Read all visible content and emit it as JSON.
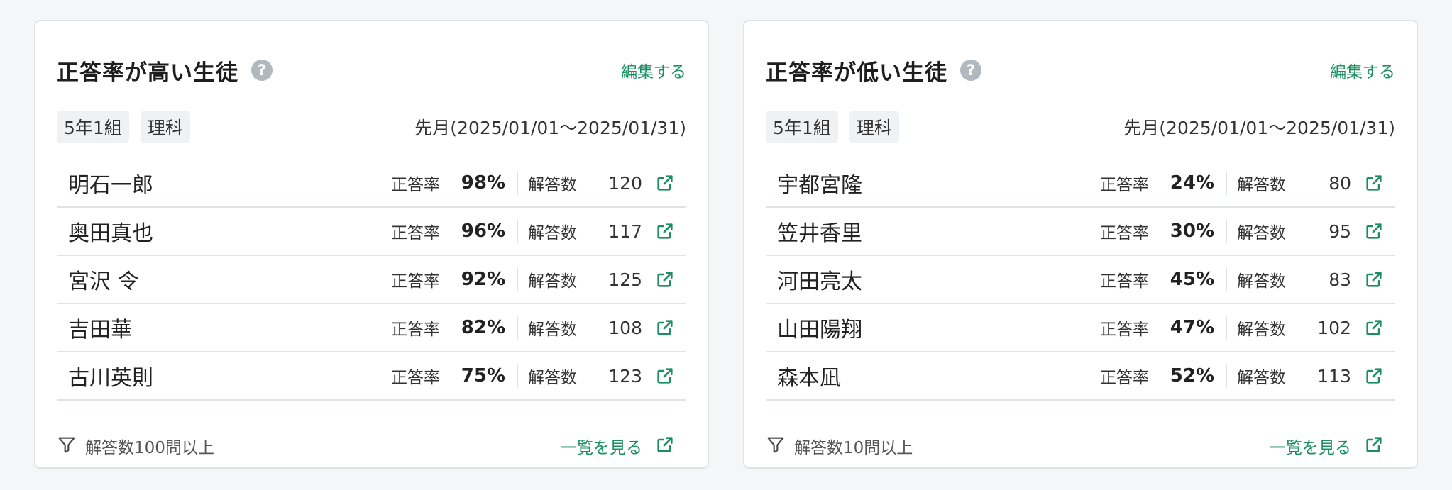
{
  "cards": [
    {
      "title": "正答率が高い生徒",
      "help": "?",
      "edit": "編集する",
      "tags": [
        "5年1組",
        "理科"
      ],
      "period": "先月(2025/01/01〜2025/01/31)",
      "rate_label": "正答率",
      "count_label": "解答数",
      "rows": [
        {
          "name": "明石一郎",
          "rate": "98%",
          "count": "120"
        },
        {
          "name": "奥田真也",
          "rate": "96%",
          "count": "117"
        },
        {
          "name": "宮沢 令",
          "rate": "92%",
          "count": "125"
        },
        {
          "name": "吉田華",
          "rate": "82%",
          "count": "108"
        },
        {
          "name": "古川英則",
          "rate": "75%",
          "count": "123"
        }
      ],
      "filter": "解答数100問以上",
      "view_all": "一覧を見る"
    },
    {
      "title": "正答率が低い生徒",
      "help": "?",
      "edit": "編集する",
      "tags": [
        "5年1組",
        "理科"
      ],
      "period": "先月(2025/01/01〜2025/01/31)",
      "rate_label": "正答率",
      "count_label": "解答数",
      "rows": [
        {
          "name": "宇都宮隆",
          "rate": "24%",
          "count": "80"
        },
        {
          "name": "笠井香里",
          "rate": "30%",
          "count": "95"
        },
        {
          "name": "河田亮太",
          "rate": "45%",
          "count": "83"
        },
        {
          "name": "山田陽翔",
          "rate": "47%",
          "count": "102"
        },
        {
          "name": "森本凪",
          "rate": "52%",
          "count": "113"
        }
      ],
      "filter": "解答数10問以上",
      "view_all": "一覧を見る"
    }
  ],
  "colors": {
    "accent": "#1a8f5f",
    "border": "#dfe3e6",
    "tag_bg": "#eef2f5",
    "help_icon": "#b0b8c0"
  },
  "icons": {
    "help": "question-circle-icon",
    "external": "external-link-icon",
    "filter": "filter-funnel-icon"
  }
}
